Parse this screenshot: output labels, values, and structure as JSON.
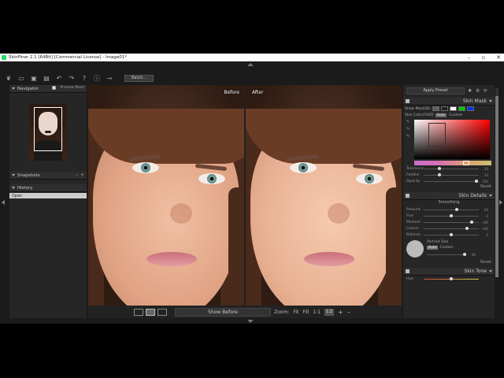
{
  "window": {
    "title": "SkinFiner 2.1 [64Bit] [Commercial License] - Image01*",
    "controls": [
      "–",
      "▫",
      "✕"
    ]
  },
  "toolbar": {
    "icons": [
      "leaf-icon",
      "folder-icon",
      "save-icon",
      "save-as-icon",
      "undo-icon",
      "redo-icon",
      "help-icon",
      "info-icon",
      "plugin-icon"
    ],
    "batch_label": "Batch..."
  },
  "navigator": {
    "title": "Navigator",
    "preview_mask_label": "Preview Mask"
  },
  "snapshots": {
    "title": "Snapshots",
    "minus": "–",
    "plus": "+"
  },
  "history": {
    "title": "History",
    "items": [
      "Open"
    ]
  },
  "canvas": {
    "before_label": "Before",
    "after_label": "After"
  },
  "bottom_bar": {
    "show_before_label": "Show Before",
    "zoom_label": "Zoom:",
    "fit_label": "Fit",
    "fill_label": "Fill",
    "one_to_one_label": "1:1",
    "zoom_value": "1:2",
    "plus": "+",
    "minus": "–"
  },
  "right_panel": {
    "apply_preset_label": "Apply Preset",
    "skin_mask": {
      "title": "Skin Mask",
      "show_mask_label": "Show Mask(B):",
      "skin_color_label": "Skin Color(F9/D)",
      "auto_label": "Auto",
      "custom_label": "Custom",
      "swatches": [
        "#222222",
        "#ffffff",
        "#00cc00",
        "#0033ff"
      ],
      "sliders": [
        {
          "label": "Tolerance",
          "value": "30",
          "pos": 0.28
        },
        {
          "label": "Feather",
          "value": "30",
          "pos": 0.28
        },
        {
          "label": "Opacity",
          "value": "100",
          "pos": 0.98
        }
      ],
      "reset_label": "Reset"
    },
    "skin_details": {
      "title": "Skin Details",
      "smoothing_label": "Smoothing",
      "sliders": [
        {
          "label": "Amount",
          "value": "60",
          "pos": 0.6
        },
        {
          "label": "Fine",
          "value": "0",
          "pos": 0.5
        },
        {
          "label": "Medium",
          "value": "+80",
          "pos": 0.9
        },
        {
          "label": "Coarse",
          "value": "+60",
          "pos": 0.8
        },
        {
          "label": "Balance",
          "value": "0",
          "pos": 0.5
        }
      ],
      "portrait_size_label": "Portrait Size",
      "portrait_auto": "Auto",
      "portrait_custom": "Custom",
      "portrait_value": "60",
      "reset_label": "Reset"
    },
    "skin_tone": {
      "title": "Skin Tone",
      "first_row_label": "Hue"
    }
  }
}
